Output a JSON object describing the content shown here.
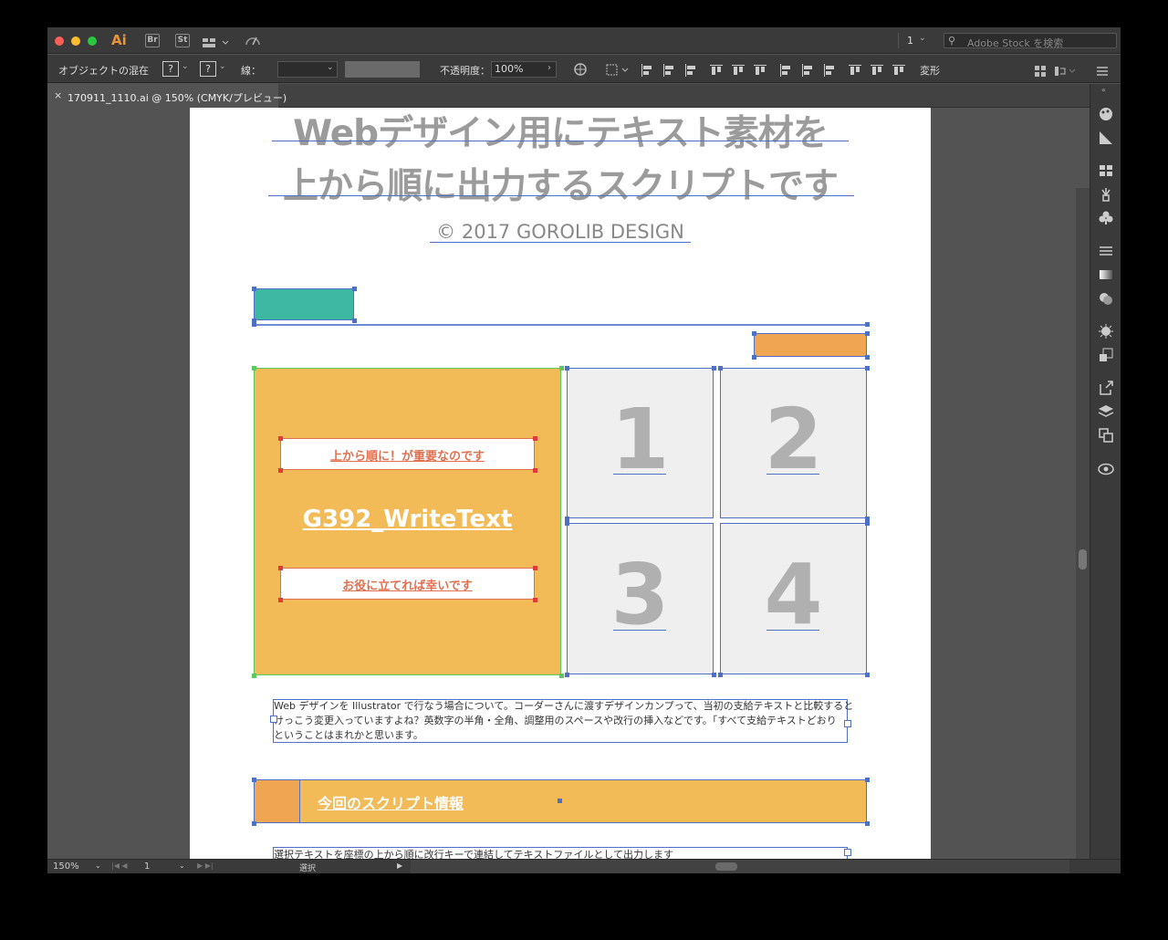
{
  "app": {
    "icon": "Ai",
    "bridge_label": "Br",
    "stock_label": "St",
    "page_select": "1",
    "search_placeholder": "Adobe Stock を検索"
  },
  "control_bar": {
    "object_type": "オブジェクトの混在",
    "fill_q": "?",
    "stroke_q": "?",
    "stroke_label": "線：",
    "opacity_label": "不透明度：",
    "opacity_value": "100%",
    "transform_label": "変形"
  },
  "document_tab": {
    "title": "170911_1110.ai @ 150% (CMYK/プレビュー)",
    "close": "×"
  },
  "artboard": {
    "heading_line1": "Webデザイン用にテキスト素材を",
    "heading_line2": "上から順に出力するスクリプトです",
    "copyright": "© 2017 GOROLIB DESIGN",
    "hero_caption_top": "上から順に！が重要なのです",
    "hero_title": "G392_WriteText",
    "hero_caption_bottom": "お役に立てれば幸いです",
    "tiles": [
      "1",
      "2",
      "3",
      "4"
    ],
    "body_text_1": "Web デザインを Illustrator で行なう場合について。コーダーさんに渡すデザインカンプって、当初の支給テキストと比較すると",
    "body_text_2": "けっこう変更入っていますよね？英数字の半角・全角、調整用のスペースや改行の挿入などです。「すべて支給テキストどおり",
    "body_text_3": "ということはまれかと思います。",
    "section_title": "今回のスクリプト情報",
    "section_desc": "選択テキストを座標の上から順に改行キーで連結してテキストファイルとして出力します"
  },
  "status_bar": {
    "zoom": "150%",
    "artboard_num": "1",
    "mode": "選択"
  },
  "colors": {
    "teal": "#3fb8a3",
    "orange": "#f0a552",
    "hero_yellow": "#f2bb57",
    "tile_gray": "#efefef",
    "selection_blue": "#4d6fc4",
    "caption_red": "#e07050"
  }
}
